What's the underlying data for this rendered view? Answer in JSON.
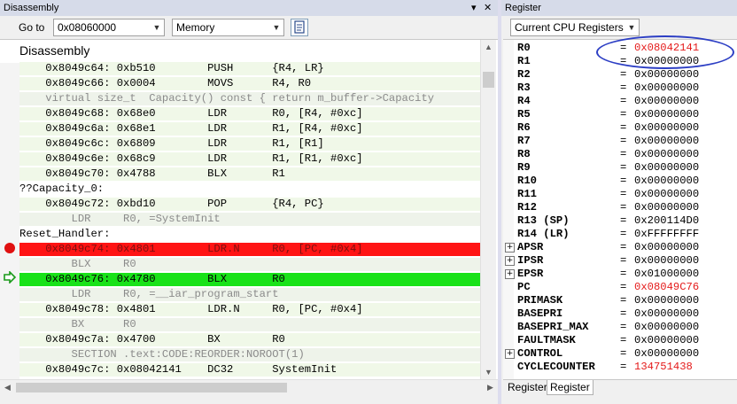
{
  "disassembly_panel": {
    "title": "Disassembly",
    "goto_label": "Go to",
    "goto_value": "0x08060000",
    "memory_option": "Memory",
    "header": "Disassembly",
    "lines": [
      {
        "kind": "code",
        "text": "    0x8049c64: 0xb510        PUSH      {R4, LR}"
      },
      {
        "kind": "code",
        "text": "    0x8049c66: 0x0004        MOVS      R4, R0"
      },
      {
        "kind": "src",
        "text": "    virtual size_t  Capacity() const { return m_buffer->Capacity"
      },
      {
        "kind": "code",
        "text": "    0x8049c68: 0x68e0        LDR       R0, [R4, #0xc]"
      },
      {
        "kind": "code",
        "text": "    0x8049c6a: 0x68e1        LDR       R1, [R4, #0xc]"
      },
      {
        "kind": "code",
        "text": "    0x8049c6c: 0x6809        LDR       R1, [R1]"
      },
      {
        "kind": "code",
        "text": "    0x8049c6e: 0x68c9        LDR       R1, [R1, #0xc]"
      },
      {
        "kind": "code",
        "text": "    0x8049c70: 0x4788        BLX       R1"
      },
      {
        "kind": "label",
        "text": "??Capacity_0:"
      },
      {
        "kind": "code",
        "text": "    0x8049c72: 0xbd10        POP       {R4, PC}"
      },
      {
        "kind": "src",
        "text": "        LDR     R0, =SystemInit"
      },
      {
        "kind": "label",
        "text": "Reset_Handler:"
      },
      {
        "kind": "bp",
        "text": "    0x8049c74: 0x4801        LDR.N     R0, [PC, #0x4]"
      },
      {
        "kind": "src",
        "text": "        BLX     R0"
      },
      {
        "kind": "pc",
        "text": "    0x8049c76: 0x4780        BLX       R0"
      },
      {
        "kind": "src",
        "text": "        LDR     R0, =__iar_program_start"
      },
      {
        "kind": "code",
        "text": "    0x8049c78: 0x4801        LDR.N     R0, [PC, #0x4]"
      },
      {
        "kind": "src",
        "text": "        BX      R0"
      },
      {
        "kind": "code",
        "text": "    0x8049c7a: 0x4700        BX        R0"
      },
      {
        "kind": "src",
        "text": "        SECTION .text:CODE:REORDER:NOROOT(1)"
      },
      {
        "kind": "code",
        "text": "    0x8049c7c: 0x08042141    DC32      SystemInit"
      }
    ]
  },
  "register_panel": {
    "title": "Register",
    "group_select": "Current CPU Registers",
    "registers": [
      {
        "name": "R0",
        "value": "0x08042141",
        "changed": true,
        "expandable": false
      },
      {
        "name": "R1",
        "value": "0x00000000",
        "changed": false,
        "expandable": false
      },
      {
        "name": "R2",
        "value": "0x00000000",
        "changed": false,
        "expandable": false
      },
      {
        "name": "R3",
        "value": "0x00000000",
        "changed": false,
        "expandable": false
      },
      {
        "name": "R4",
        "value": "0x00000000",
        "changed": false,
        "expandable": false
      },
      {
        "name": "R5",
        "value": "0x00000000",
        "changed": false,
        "expandable": false
      },
      {
        "name": "R6",
        "value": "0x00000000",
        "changed": false,
        "expandable": false
      },
      {
        "name": "R7",
        "value": "0x00000000",
        "changed": false,
        "expandable": false
      },
      {
        "name": "R8",
        "value": "0x00000000",
        "changed": false,
        "expandable": false
      },
      {
        "name": "R9",
        "value": "0x00000000",
        "changed": false,
        "expandable": false
      },
      {
        "name": "R10",
        "value": "0x00000000",
        "changed": false,
        "expandable": false
      },
      {
        "name": "R11",
        "value": "0x00000000",
        "changed": false,
        "expandable": false
      },
      {
        "name": "R12",
        "value": "0x00000000",
        "changed": false,
        "expandable": false
      },
      {
        "name": "R13 (SP)",
        "value": "0x200114D0",
        "changed": false,
        "expandable": false
      },
      {
        "name": "R14 (LR)",
        "value": "0xFFFFFFFF",
        "changed": false,
        "expandable": false
      },
      {
        "name": "APSR",
        "value": "0x00000000",
        "changed": false,
        "expandable": true
      },
      {
        "name": "IPSR",
        "value": "0x00000000",
        "changed": false,
        "expandable": true
      },
      {
        "name": "EPSR",
        "value": "0x01000000",
        "changed": false,
        "expandable": true
      },
      {
        "name": "PC",
        "value": "0x08049C76",
        "changed": true,
        "expandable": false
      },
      {
        "name": "PRIMASK",
        "value": "0x00000000",
        "changed": false,
        "expandable": false
      },
      {
        "name": "BASEPRI",
        "value": "0x00000000",
        "changed": false,
        "expandable": false
      },
      {
        "name": "BASEPRI_MAX",
        "value": "0x00000000",
        "changed": false,
        "expandable": false
      },
      {
        "name": "FAULTMASK",
        "value": "0x00000000",
        "changed": false,
        "expandable": false
      },
      {
        "name": "CONTROL",
        "value": "0x00000000",
        "changed": false,
        "expandable": true
      },
      {
        "name": "CYCLECOUNTER",
        "value": "134751438",
        "changed": true,
        "expandable": false
      }
    ],
    "tabs": [
      "Register",
      "Register"
    ]
  },
  "colors": {
    "breakpoint_row": "#ff1414",
    "current_pc_row": "#19e219",
    "changed_value": "#e41a1a",
    "annotation_ellipse": "#2c3ec4"
  }
}
